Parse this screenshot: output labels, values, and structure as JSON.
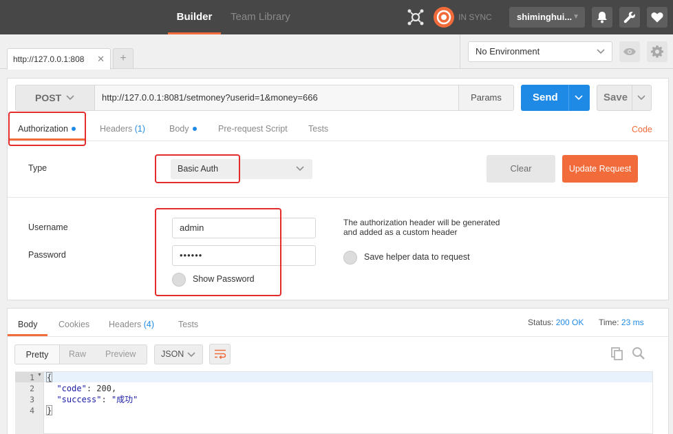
{
  "topbar": {
    "nav": {
      "builder": "Builder",
      "team_library": "Team Library"
    },
    "sync_text": "IN SYNC",
    "user": "shiminghui...",
    "colors": {
      "bg": "#474747",
      "accent": "#f26b3a"
    }
  },
  "tabs": {
    "current": "http://127.0.0.1:808",
    "add": "+",
    "environment": "No Environment"
  },
  "request": {
    "method": "POST",
    "url": "http://127.0.0.1:8081/setmoney?userid=1&money=666",
    "params": "Params",
    "send": "Send",
    "save": "Save",
    "subtabs": {
      "authorization": "Authorization",
      "headers": "Headers",
      "headers_count": "(1)",
      "body": "Body",
      "prerequest": "Pre-request Script",
      "tests": "Tests"
    },
    "code": "Code"
  },
  "auth": {
    "type_label": "Type",
    "type_value": "Basic Auth",
    "clear": "Clear",
    "update": "Update Request",
    "username_label": "Username",
    "username_value": "admin",
    "password_label": "Password",
    "password_value": "••••••",
    "show_password": "Show Password",
    "info_line1": "The authorization header will be generated",
    "info_line2": "and added as a custom header",
    "save_helper": "Save helper data to request"
  },
  "response": {
    "tabs": {
      "body": "Body",
      "cookies": "Cookies",
      "headers": "Headers",
      "headers_count": "(4)",
      "tests": "Tests"
    },
    "status_label": "Status:",
    "status_value": "200 OK",
    "time_label": "Time:",
    "time_value": "23 ms",
    "view": {
      "pretty": "Pretty",
      "raw": "Raw",
      "preview": "Preview"
    },
    "format": "JSON",
    "lines": [
      {
        "num": "1",
        "text": "{"
      },
      {
        "num": "2",
        "key": "\"code\"",
        "sep": ": ",
        "value": "200,"
      },
      {
        "num": "3",
        "key": "\"success\"",
        "sep": ": ",
        "value": "\"成功\""
      },
      {
        "num": "4",
        "text": "}"
      }
    ]
  }
}
